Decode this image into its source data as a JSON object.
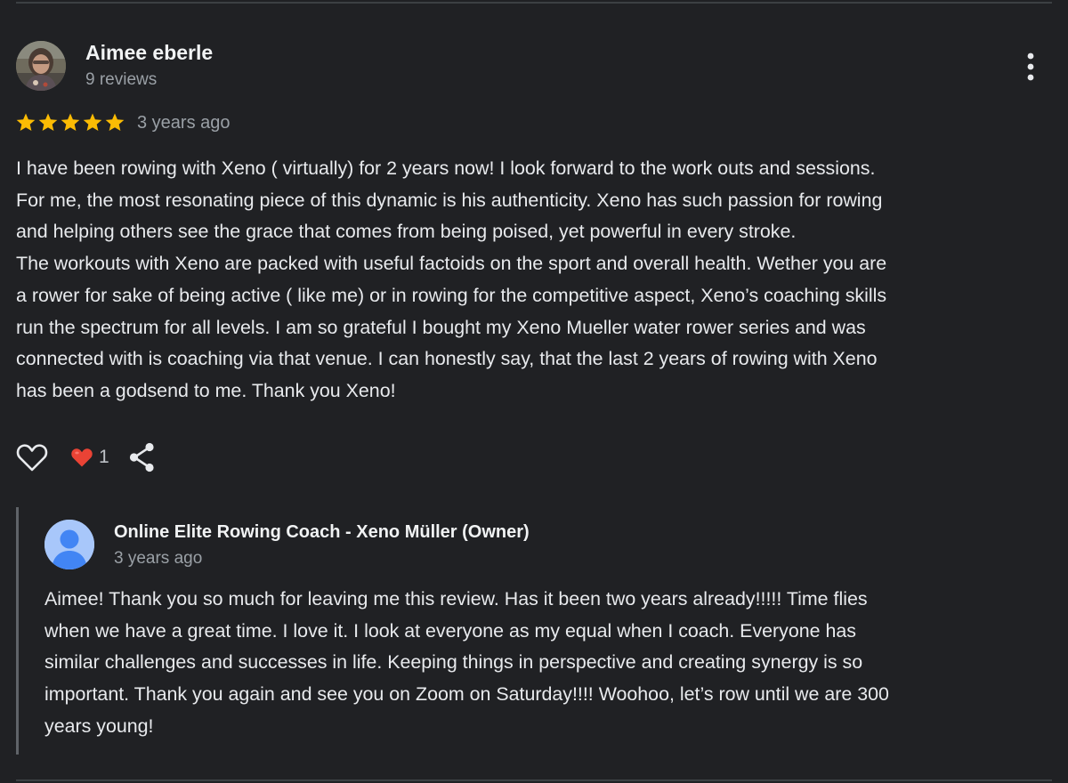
{
  "review": {
    "author": {
      "name": "Aimee eberle",
      "meta": "9 reviews",
      "avatar_icon": "user-photo-avatar"
    },
    "rating": 5,
    "rating_max": 5,
    "date": "3 years ago",
    "more_icon": "more-vert-icon",
    "text_lines": [
      "I have been rowing with Xeno ( virtually) for 2 years now! I look forward to the work outs and sessions.",
      "For me, the most resonating piece of this dynamic is his authenticity. Xeno has such passion for rowing",
      "and helping others see the grace that comes from being poised, yet powerful in every stroke.",
      "The workouts with Xeno are packed with useful factoids on the sport and overall health. Wether you are",
      "a rower for sake of being active ( like me) or in rowing for the competitive aspect, Xeno’s coaching skills",
      "run the spectrum for all levels. I am so grateful I bought my Xeno Mueller water rower series and was",
      "connected with is coaching via that venue. I can honestly say, that the last 2 years of rowing with Xeno",
      "has been a godsend to me. Thank you Xeno!"
    ],
    "actions": {
      "like_icon": "heart-outline-icon",
      "reaction_icon": "red-heart-icon",
      "reaction_count": "1",
      "share_icon": "share-icon"
    }
  },
  "owner_reply": {
    "name": "Online Elite Rowing Coach - Xeno Müller (Owner)",
    "date": "3 years ago",
    "avatar_icon": "default-user-avatar",
    "text_lines": [
      "Aimee! Thank you so much for leaving me this review. Has it been two years already!!!!! Time flies",
      "when we have a great time. I love it. I look at everyone as my equal when I coach. Everyone has",
      "similar challenges and successes in life. Keeping things in perspective and creating synergy is so",
      "important. Thank you again and see you on Zoom on Saturday!!!! Woohoo, let’s row until we are 300",
      "years young!"
    ]
  },
  "colors": {
    "background": "#202124",
    "star": "#fbbc04",
    "reaction_heart": "#ea4335",
    "owner_avatar_bg": "#a8c7fa",
    "owner_avatar_fg": "#4285f4"
  }
}
